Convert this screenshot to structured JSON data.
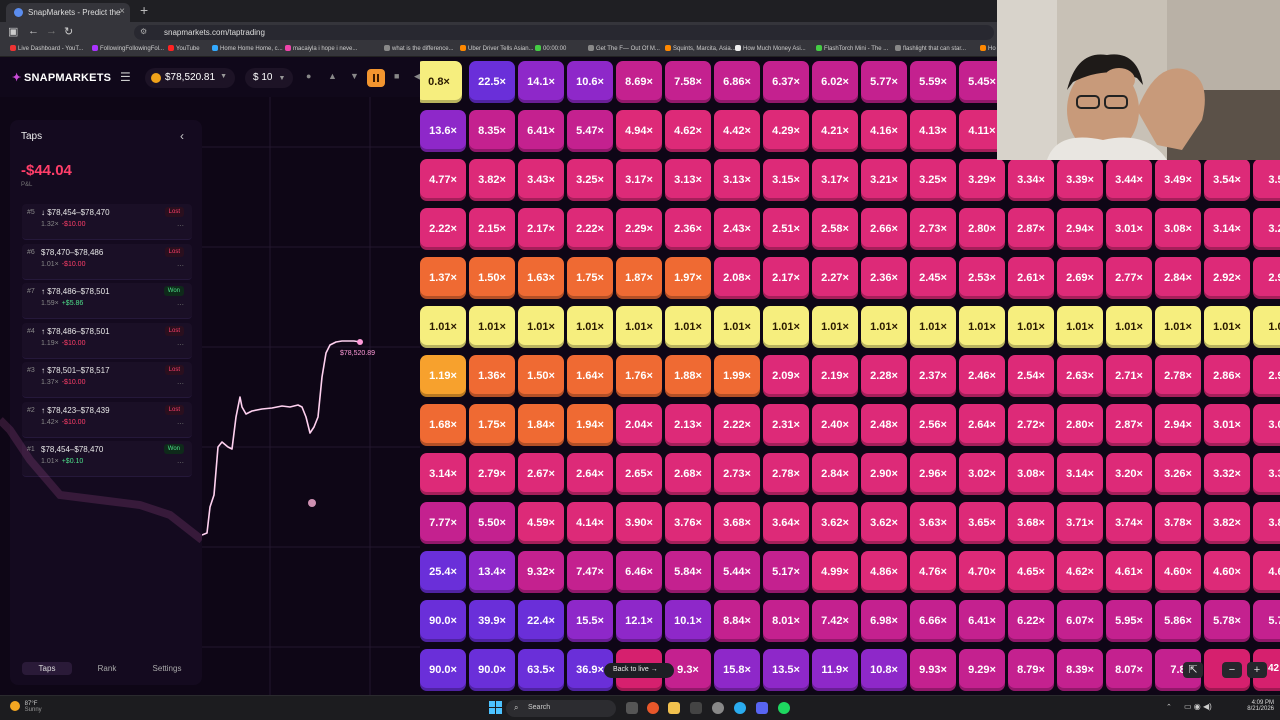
{
  "browser": {
    "tab_title": "SnapMarkets - Predict the",
    "url": "snapmarkets.com/taptrading",
    "bookmarks": [
      {
        "label": "Live Dashboard - YouT...",
        "color": "#e33"
      },
      {
        "label": "FollowingFollowingFol...",
        "color": "#a3f"
      },
      {
        "label": "YouTube",
        "color": "#f22"
      },
      {
        "label": "Home Home Home, c...",
        "color": "#3af"
      },
      {
        "label": "macaiyla i hope i neve...",
        "color": "#e4a"
      },
      {
        "label": "what is the difference...",
        "color": "#888"
      },
      {
        "label": "Uber Driver Tells Asian...",
        "color": "#f80"
      },
      {
        "label": "00:00:00",
        "color": "#4c4"
      },
      {
        "label": "Get The F— Out Of M...",
        "color": "#888"
      },
      {
        "label": "Squints, Marcita, Asia...",
        "color": "#f80"
      },
      {
        "label": "How Much Money Asi...",
        "color": "#eee"
      },
      {
        "label": "FlashTorch Mini - The ...",
        "color": "#4c4"
      },
      {
        "label": "flashlight that can star...",
        "color": "#888"
      },
      {
        "label": "Ho",
        "color": "#f80"
      }
    ]
  },
  "app": {
    "logo": "SNAPMARKETS",
    "balance": "$78,520.81",
    "bet_amount": "$ 10"
  },
  "panel": {
    "title": "Taps",
    "pnl_value": "-$44.04",
    "pnl_label": "P&L",
    "taps": [
      {
        "id": "#5",
        "dir": "↓",
        "range": "$78,454–$78,470",
        "mult": "1.32×",
        "pnl": "-$10.00",
        "status": "Lost"
      },
      {
        "id": "#6",
        "dir": "",
        "range": "$78,470–$78,486",
        "mult": "1.01×",
        "pnl": "-$10.00",
        "status": "Lost"
      },
      {
        "id": "#7",
        "dir": "↑",
        "range": "$78,486–$78,501",
        "mult": "1.59×",
        "pnl": "+$5.86",
        "status": "Won"
      },
      {
        "id": "#4",
        "dir": "↑",
        "range": "$78,486–$78,501",
        "mult": "1.19×",
        "pnl": "-$10.00",
        "status": "Lost"
      },
      {
        "id": "#3",
        "dir": "↑",
        "range": "$78,501–$78,517",
        "mult": "1.37×",
        "pnl": "-$10.00",
        "status": "Lost"
      },
      {
        "id": "#2",
        "dir": "↑",
        "range": "$78,423–$78,439",
        "mult": "1.42×",
        "pnl": "-$10.00",
        "status": "Lost"
      },
      {
        "id": "#1",
        "dir": "",
        "range": "$78,454–$78,470",
        "mult": "1.01×",
        "pnl": "+$0.10",
        "status": "Won"
      }
    ],
    "nav": [
      "Taps",
      "Rank",
      "Settings"
    ]
  },
  "chart": {
    "price_label": "$78,520.89"
  },
  "grid": {
    "rows": [
      [
        "0.8×",
        "22.5×",
        "14.1×",
        "10.6×",
        "8.69×",
        "7.58×",
        "6.86×",
        "6.37×",
        "6.02×",
        "5.77×",
        "5.59×",
        "5.45×"
      ],
      [
        "13.6×",
        "8.35×",
        "6.41×",
        "5.47×",
        "4.94×",
        "4.62×",
        "4.42×",
        "4.29×",
        "4.21×",
        "4.16×",
        "4.13×",
        "4.11×"
      ],
      [
        "4.77×",
        "3.82×",
        "3.43×",
        "3.25×",
        "3.17×",
        "3.13×",
        "3.13×",
        "3.15×",
        "3.17×",
        "3.21×",
        "3.25×",
        "3.29×",
        "3.34×",
        "3.39×",
        "3.44×",
        "3.49×",
        "3.54×",
        "3.5"
      ],
      [
        "2.22×",
        "2.15×",
        "2.17×",
        "2.22×",
        "2.29×",
        "2.36×",
        "2.43×",
        "2.51×",
        "2.58×",
        "2.66×",
        "2.73×",
        "2.80×",
        "2.87×",
        "2.94×",
        "3.01×",
        "3.08×",
        "3.14×",
        "3.2"
      ],
      [
        "1.37×",
        "1.50×",
        "1.63×",
        "1.75×",
        "1.87×",
        "1.97×",
        "2.08×",
        "2.17×",
        "2.27×",
        "2.36×",
        "2.45×",
        "2.53×",
        "2.61×",
        "2.69×",
        "2.77×",
        "2.84×",
        "2.92×",
        "2.9"
      ],
      [
        "1.01×",
        "1.01×",
        "1.01×",
        "1.01×",
        "1.01×",
        "1.01×",
        "1.01×",
        "1.01×",
        "1.01×",
        "1.01×",
        "1.01×",
        "1.01×",
        "1.01×",
        "1.01×",
        "1.01×",
        "1.01×",
        "1.01×",
        "1.0"
      ],
      [
        "1.19×",
        "1.36×",
        "1.50×",
        "1.64×",
        "1.76×",
        "1.88×",
        "1.99×",
        "2.09×",
        "2.19×",
        "2.28×",
        "2.37×",
        "2.46×",
        "2.54×",
        "2.63×",
        "2.71×",
        "2.78×",
        "2.86×",
        "2.9"
      ],
      [
        "1.68×",
        "1.75×",
        "1.84×",
        "1.94×",
        "2.04×",
        "2.13×",
        "2.22×",
        "2.31×",
        "2.40×",
        "2.48×",
        "2.56×",
        "2.64×",
        "2.72×",
        "2.80×",
        "2.87×",
        "2.94×",
        "3.01×",
        "3.0"
      ],
      [
        "3.14×",
        "2.79×",
        "2.67×",
        "2.64×",
        "2.65×",
        "2.68×",
        "2.73×",
        "2.78×",
        "2.84×",
        "2.90×",
        "2.96×",
        "3.02×",
        "3.08×",
        "3.14×",
        "3.20×",
        "3.26×",
        "3.32×",
        "3.3"
      ],
      [
        "7.77×",
        "5.50×",
        "4.59×",
        "4.14×",
        "3.90×",
        "3.76×",
        "3.68×",
        "3.64×",
        "3.62×",
        "3.62×",
        "3.63×",
        "3.65×",
        "3.68×",
        "3.71×",
        "3.74×",
        "3.78×",
        "3.82×",
        "3.8"
      ],
      [
        "25.4×",
        "13.4×",
        "9.32×",
        "7.47×",
        "6.46×",
        "5.84×",
        "5.44×",
        "5.17×",
        "4.99×",
        "4.86×",
        "4.76×",
        "4.70×",
        "4.65×",
        "4.62×",
        "4.61×",
        "4.60×",
        "4.60×",
        "4.6"
      ],
      [
        "90.0×",
        "39.9×",
        "22.4×",
        "15.5×",
        "12.1×",
        "10.1×",
        "8.84×",
        "8.01×",
        "7.42×",
        "6.98×",
        "6.66×",
        "6.41×",
        "6.22×",
        "6.07×",
        "5.95×",
        "5.86×",
        "5.78×",
        "5.7"
      ],
      [
        "90.0×",
        "90.0×",
        "63.5×",
        "36.9×",
        "",
        "9.3×",
        "15.8×",
        "13.5×",
        "11.9×",
        "10.8×",
        "9.93×",
        "9.29×",
        "8.79×",
        "8.39×",
        "8.07×",
        "7.8",
        "",
        ""
      ]
    ],
    "back_to_live": "Back to live →",
    "zoom_in": "+",
    "zoom_out": "−",
    "zoom_edge": "42"
  },
  "taskbar": {
    "weather_temp": "87°F",
    "weather_cond": "Sunny",
    "search": "Search",
    "time": "4:09 PM",
    "date": "8/21/2026"
  }
}
